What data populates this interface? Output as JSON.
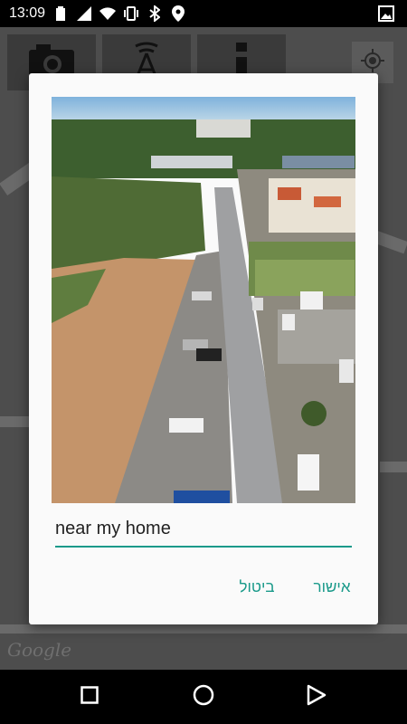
{
  "status_bar": {
    "time": "13:09",
    "icons": [
      "battery-icon",
      "signal-icon",
      "wifi-icon",
      "vibrate-icon",
      "bluetooth-icon",
      "location-icon"
    ],
    "right_icon": "gallery-icon"
  },
  "map": {
    "toolbar_icons": [
      "camera-icon",
      "tower-icon",
      "more-icon"
    ],
    "my_location_icon": "my-location-icon",
    "watermark": "Google"
  },
  "dialog": {
    "photo_name": "aerial-street-photo",
    "input_value": "near my home",
    "cancel_label": "ביטול",
    "ok_label": "אישור",
    "accent_color": "#1a9a8a"
  },
  "nav_bar": {
    "buttons": [
      "recents-button",
      "home-button",
      "back-button"
    ]
  }
}
